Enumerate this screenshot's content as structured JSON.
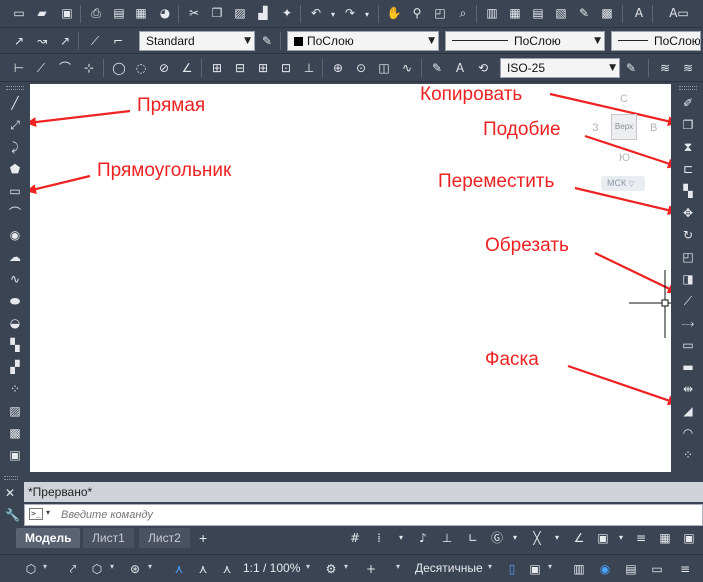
{
  "toolbar_row1": {
    "icons": [
      "new-icon",
      "open-icon",
      "save-icon",
      "print-icon",
      "print-preview-icon",
      "publish-icon",
      "render-icon",
      "cut-icon",
      "copy-icon",
      "paste-icon",
      "match-properties-icon",
      "block-editor-icon",
      "undo-icon",
      "redo-icon",
      "pan-icon",
      "zoom-realtime-icon",
      "zoom-window-icon",
      "zoom-previous-icon",
      "properties-icon",
      "design-center-icon",
      "tool-palettes-icon",
      "sheet-set-icon",
      "markup-icon",
      "calculator-icon",
      "text-style-icon"
    ]
  },
  "toolbar_row2": {
    "visual_style": "Standard",
    "color": "ПоСлою",
    "linetype": "ПоСлою",
    "lineweight": "ПоСлою"
  },
  "toolbar_row3": {
    "dim_style": "ISO-25"
  },
  "canvas": {
    "labels": {
      "line": "Прямая",
      "rectangle": "Прямоугольник",
      "copy": "Копировать",
      "scale": "Подобие",
      "move": "Переместить",
      "trim": "Обрезать",
      "chamfer": "Фаска"
    },
    "viewcube": {
      "north": "С",
      "south": "Ю",
      "west": "З",
      "east": "В",
      "face": "Верх",
      "ucs": "МСК"
    }
  },
  "command_line": {
    "history": "*Прервано*",
    "placeholder": "Введите команду"
  },
  "layout_tabs": {
    "items": [
      "Модель",
      "Лист1",
      "Лист2"
    ],
    "active": "Модель"
  },
  "status_bar": {
    "scale": "1:1 / 100%",
    "units": "Десятичные"
  },
  "colors": {
    "annotation": "#ee2222",
    "ui_background": "#3b4453",
    "canvas": "#ffffff"
  }
}
